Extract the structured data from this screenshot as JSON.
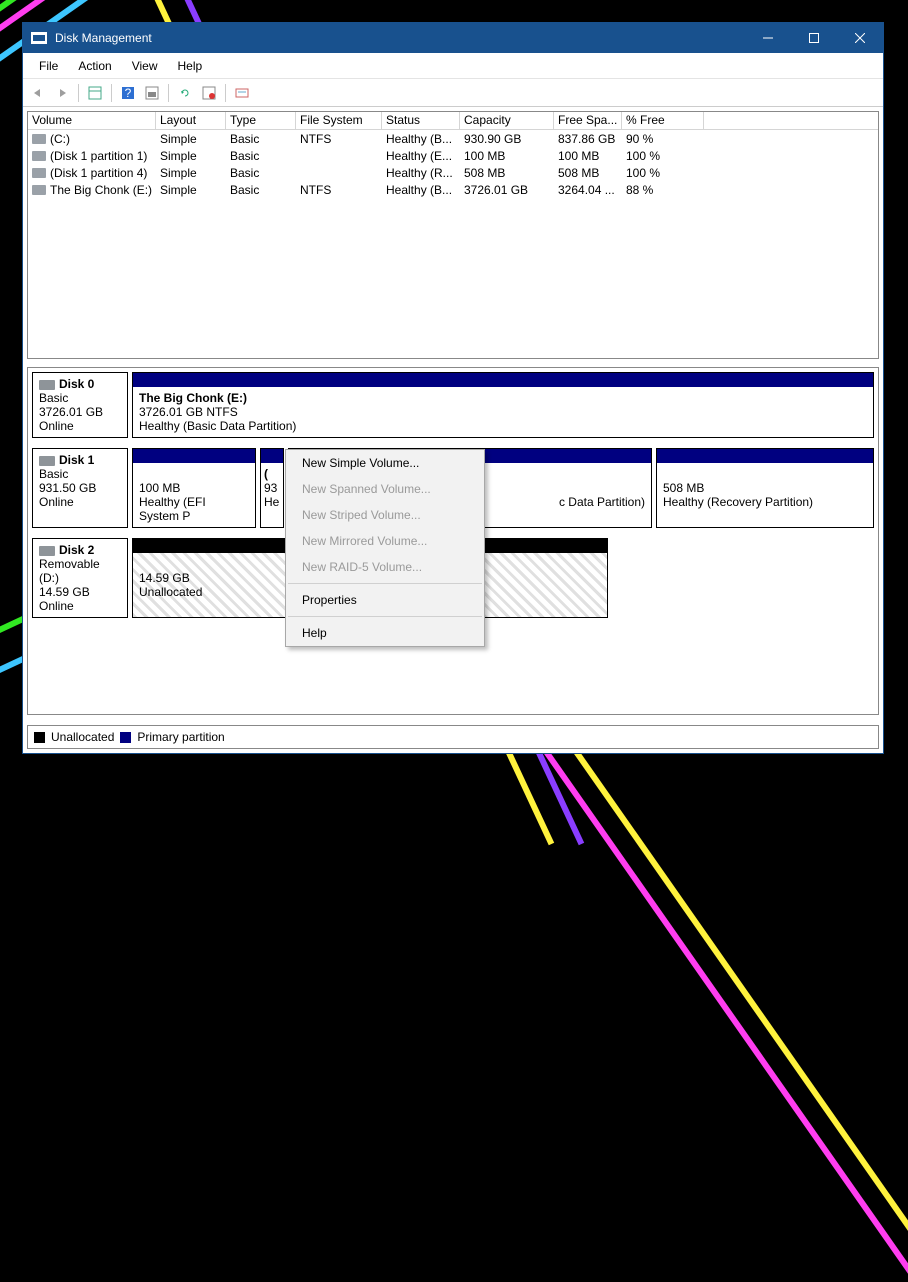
{
  "window": {
    "title": "Disk Management"
  },
  "menubar": [
    "File",
    "Action",
    "View",
    "Help"
  ],
  "columns": {
    "volume": "Volume",
    "layout": "Layout",
    "type": "Type",
    "fs": "File System",
    "status": "Status",
    "capacity": "Capacity",
    "free": "Free Spa...",
    "pct": "% Free"
  },
  "rows": [
    {
      "volume": "(C:)",
      "layout": "Simple",
      "type": "Basic",
      "fs": "NTFS",
      "status": "Healthy (B...",
      "capacity": "930.90 GB",
      "free": "837.86 GB",
      "pct": "90 %"
    },
    {
      "volume": "(Disk 1 partition 1)",
      "layout": "Simple",
      "type": "Basic",
      "fs": "",
      "status": "Healthy (E...",
      "capacity": "100 MB",
      "free": "100 MB",
      "pct": "100 %"
    },
    {
      "volume": "(Disk 1 partition 4)",
      "layout": "Simple",
      "type": "Basic",
      "fs": "",
      "status": "Healthy (R...",
      "capacity": "508 MB",
      "free": "508 MB",
      "pct": "100 %"
    },
    {
      "volume": "The Big Chonk (E:)",
      "layout": "Simple",
      "type": "Basic",
      "fs": "NTFS",
      "status": "Healthy (B...",
      "capacity": "3726.01 GB",
      "free": "3264.04 ...",
      "pct": "88 %"
    }
  ],
  "disks": {
    "d0": {
      "name": "Disk 0",
      "type": "Basic",
      "size": "3726.01 GB",
      "state": "Online",
      "p0": {
        "name": "The Big Chonk  (E:)",
        "size": "3726.01 GB NTFS",
        "status": "Healthy (Basic Data Partition)"
      }
    },
    "d1": {
      "name": "Disk 1",
      "type": "Basic",
      "size": "931.50 GB",
      "state": "Online",
      "p0": {
        "size": "100 MB",
        "status": "Healthy (EFI System P"
      },
      "p1": {
        "name": "(",
        "size": "93",
        "status": "He"
      },
      "p2": {
        "status": "c Data Partition)"
      },
      "p3": {
        "size": "508 MB",
        "status": "Healthy (Recovery Partition)"
      }
    },
    "d2": {
      "name": "Disk 2",
      "type": "Removable (D:)",
      "size": "14.59 GB",
      "state": "Online",
      "p0": {
        "size": "14.59 GB",
        "status": "Unallocated"
      }
    }
  },
  "legend": {
    "unalloc": "Unallocated",
    "primary": "Primary partition"
  },
  "ctx": {
    "simple": "New Simple Volume...",
    "spanned": "New Spanned Volume...",
    "striped": "New Striped Volume...",
    "mirrored": "New Mirrored Volume...",
    "raid5": "New RAID-5 Volume...",
    "props": "Properties",
    "help": "Help"
  }
}
